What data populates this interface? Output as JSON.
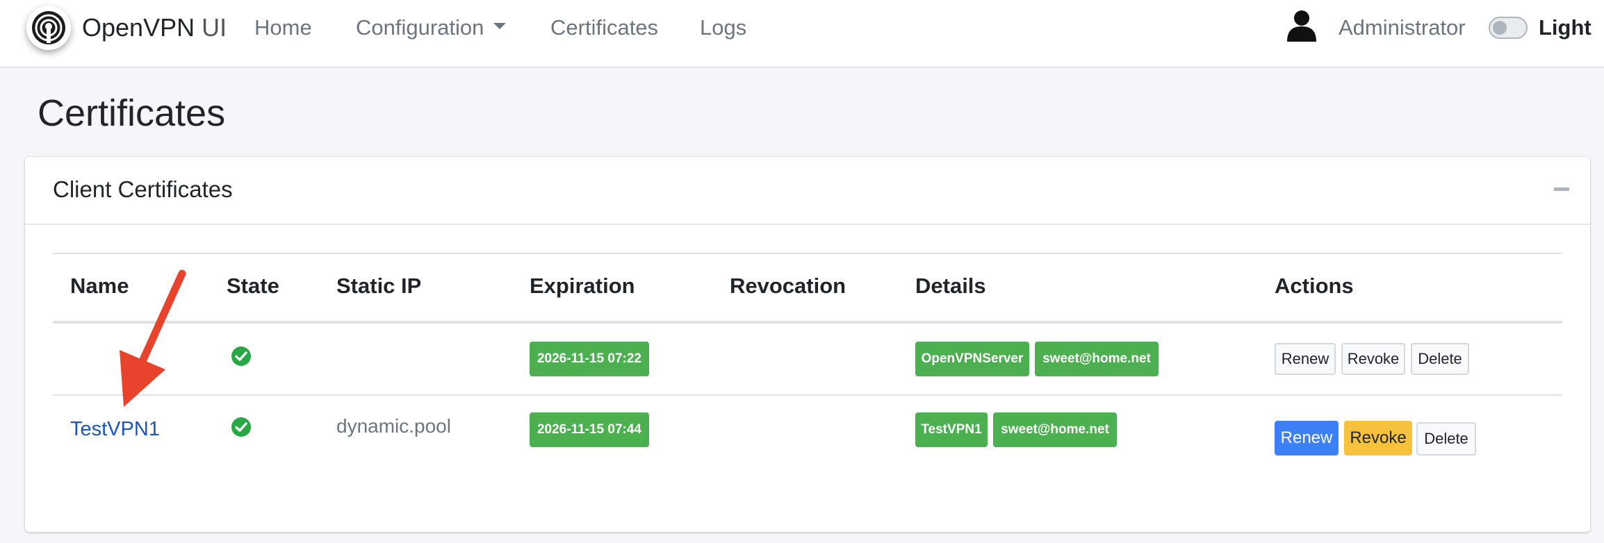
{
  "navbar": {
    "brand_main": "OpenVPN",
    "brand_suffix": "UI",
    "links": {
      "home": "Home",
      "configuration": "Configuration",
      "certificates": "Certificates",
      "logs": "Logs"
    },
    "user": "Administrator",
    "theme_label": "Light"
  },
  "page": {
    "title": "Certificates"
  },
  "card": {
    "title": "Client Certificates"
  },
  "table": {
    "headers": {
      "name": "Name",
      "state": "State",
      "static_ip": "Static IP",
      "expiration": "Expiration",
      "revocation": "Revocation",
      "details": "Details",
      "actions": "Actions"
    },
    "rows": [
      {
        "name": "",
        "static_ip": "",
        "expiration": "2026-11-15 07:22",
        "revocation": "",
        "details": [
          "OpenVPNServer",
          "sweet@home.net"
        ],
        "actions": [
          "Renew",
          "Revoke",
          "Delete"
        ]
      },
      {
        "name": "TestVPN1",
        "static_ip": "dynamic.pool",
        "expiration": "2026-11-15 07:44",
        "revocation": "",
        "details": [
          "TestVPN1",
          "sweet@home.net"
        ],
        "actions": [
          "Renew",
          "Revoke",
          "Delete"
        ]
      }
    ]
  },
  "colors": {
    "badge_green": "#4caf50",
    "primary": "#3d7ff5",
    "warning": "#f6c23e",
    "annotation_arrow": "#e8432d"
  }
}
